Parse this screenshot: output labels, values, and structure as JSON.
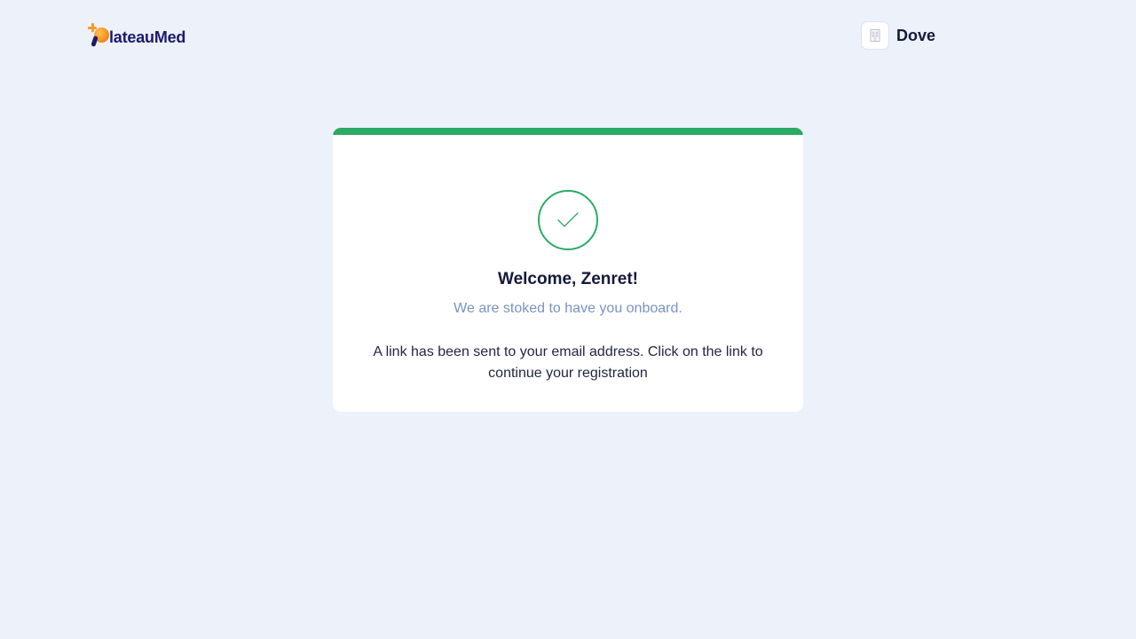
{
  "header": {
    "logo_text": "lateauMed",
    "organization_name": "Dove"
  },
  "card": {
    "title": "Welcome, Zenret!",
    "subtitle": "We are stoked to have you onboard.",
    "message": "A link has been sent to your email address. Click on the link to continue your registration"
  },
  "colors": {
    "background": "#edf1f9",
    "success_green": "#2aaa63",
    "brand_navy": "#1c1a6f",
    "brand_orange": "#f7941d",
    "subtitle_blue": "#7a93c2"
  },
  "icons": {
    "success": "check-circle-icon",
    "organization": "building-icon"
  }
}
